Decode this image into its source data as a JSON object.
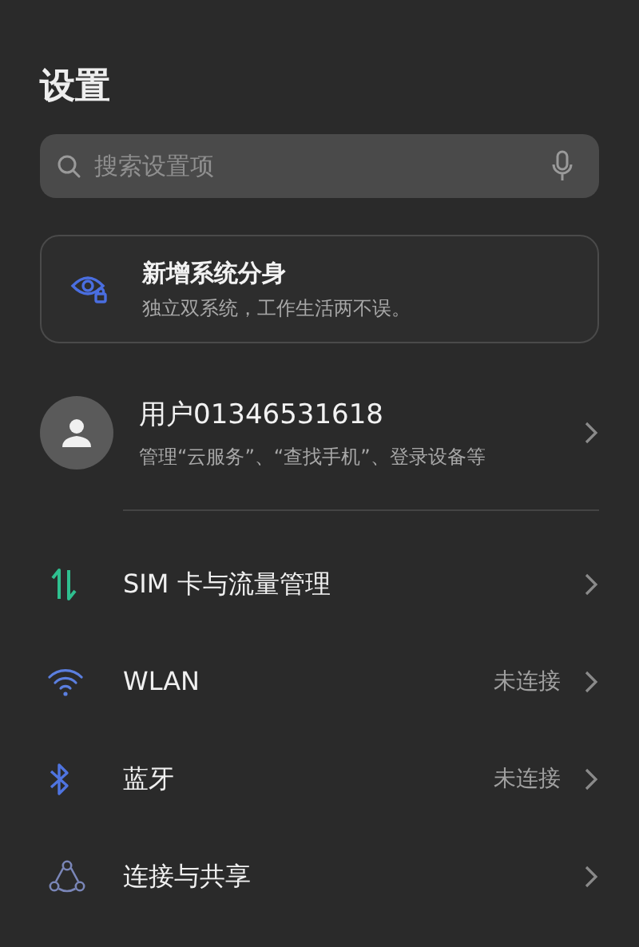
{
  "title": "设置",
  "search": {
    "placeholder": "搜索设置项"
  },
  "promo_card": {
    "title": "新增系统分身",
    "subtitle": "独立双系统，工作生活两不误。"
  },
  "account": {
    "name": "用户01346531618",
    "subtitle": "管理“云服务”、“查找手机”、登录设备等"
  },
  "items": [
    {
      "label": "SIM 卡与流量管理"
    },
    {
      "label": "WLAN",
      "value": "未连接"
    },
    {
      "label": "蓝牙",
      "value": "未连接"
    },
    {
      "label": "连接与共享"
    }
  ]
}
